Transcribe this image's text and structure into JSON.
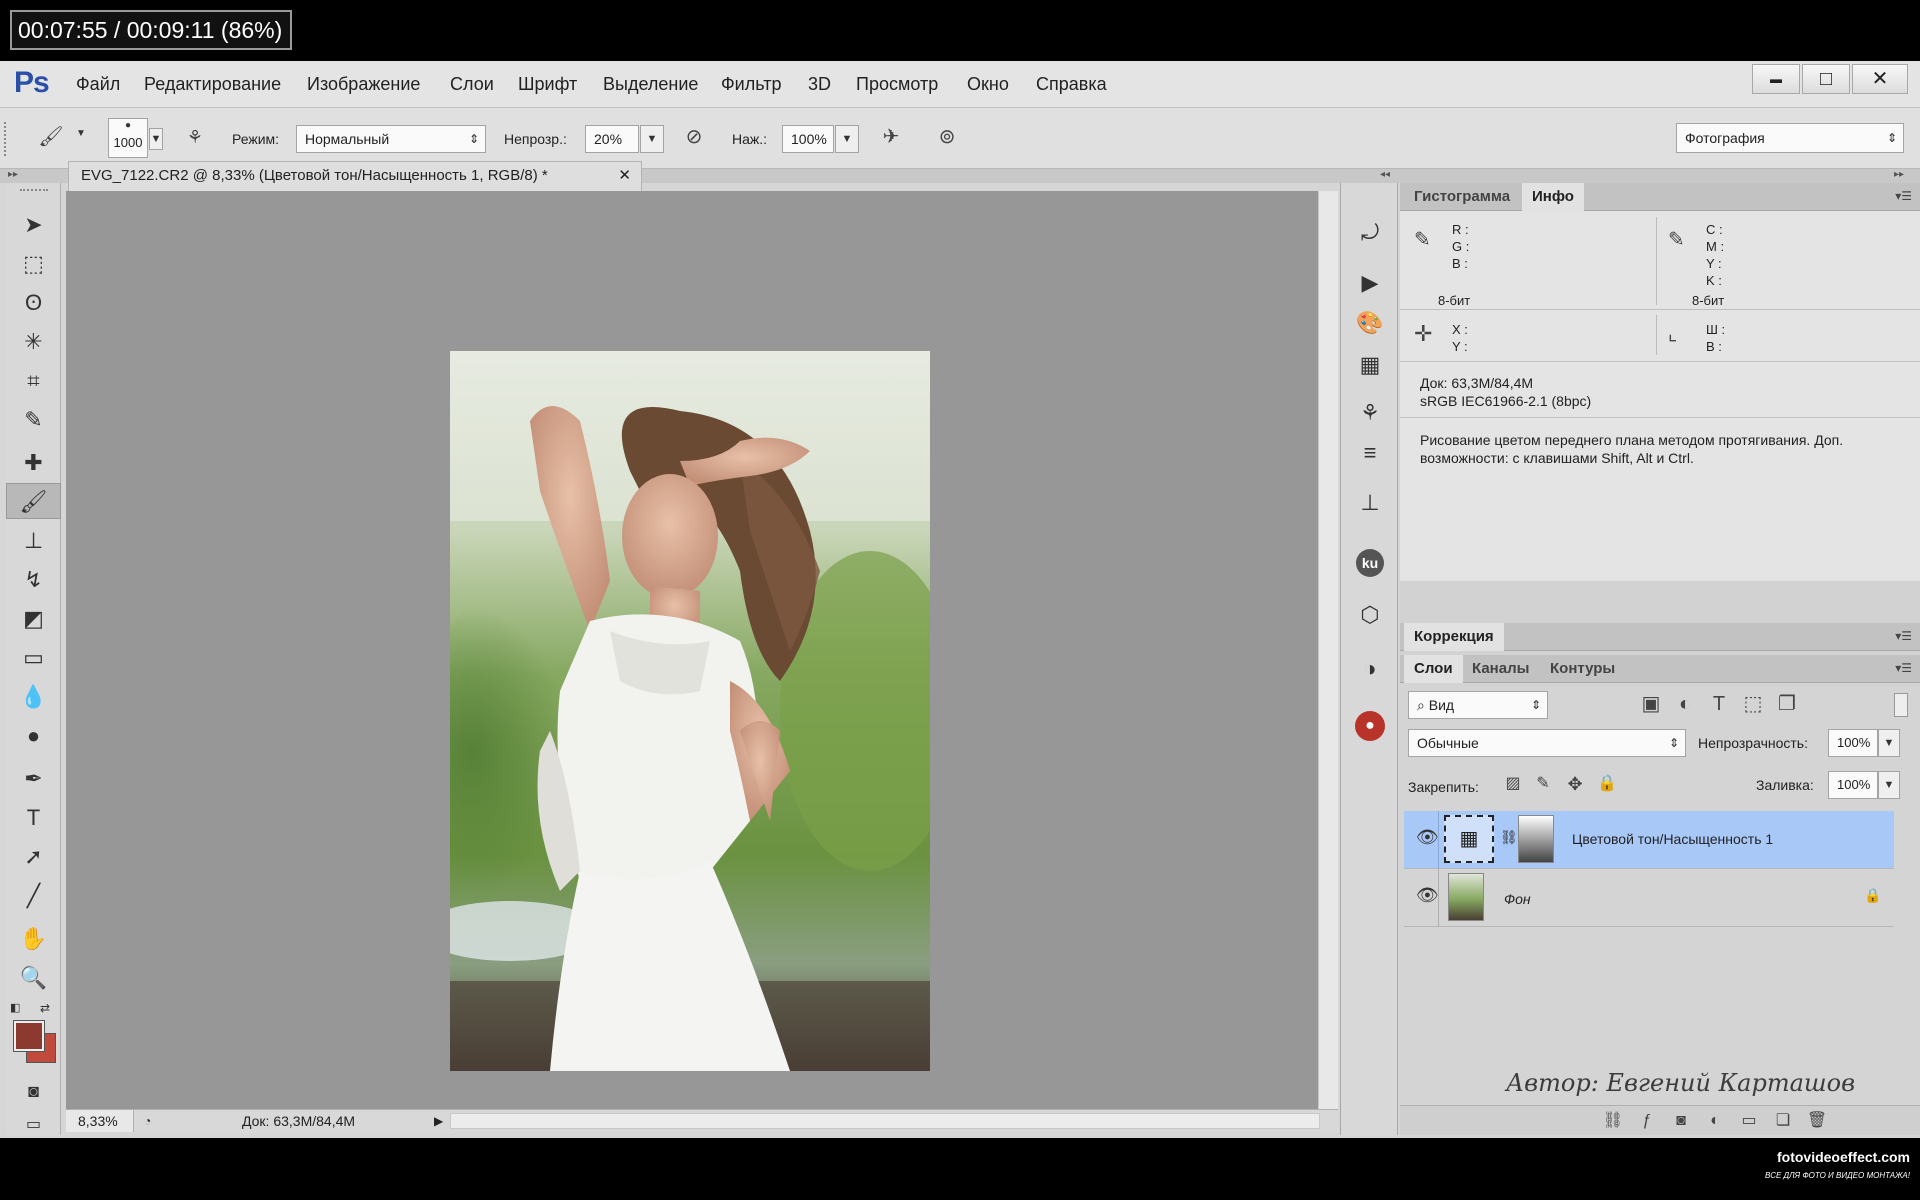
{
  "recording": {
    "timer": "00:07:55 / 00:09:11 (86%)"
  },
  "app": {
    "logo": "Ps",
    "menu": [
      "Файл",
      "Редактирование",
      "Изображение",
      "Слои",
      "Шрифт",
      "Выделение",
      "Фильтр",
      "3D",
      "Просмотр",
      "Окно",
      "Справка"
    ],
    "window_buttons": {
      "minimize": "▬",
      "maximize": "□",
      "close": "✕"
    }
  },
  "options": {
    "brush_size": "1000",
    "mode_label": "Режим:",
    "mode_value": "Нормальный",
    "opacity_label": "Непрозр.:",
    "opacity_value": "20%",
    "pressure_label": "Наж.:",
    "pressure_value": "100%",
    "workspace": "Фотография"
  },
  "document": {
    "tab_title": "EVG_7122.CR2 @ 8,33% (Цветовой тон/Насыщенность 1, RGB/8) *",
    "close": "✕",
    "zoom": "8,33%",
    "doc_size": "Док: 63,3M/84,4M"
  },
  "panels": {
    "top_tabs": [
      "Гистограмма",
      "Инфо"
    ],
    "info": {
      "rgb": [
        "R :",
        "G :",
        "B :"
      ],
      "cmyk": [
        "C :",
        "M :",
        "Y :",
        "K :"
      ],
      "bit_left": "8-бит",
      "bit_right": "8-бит",
      "xy": [
        "X :",
        "Y :"
      ],
      "wh": [
        "Ш :",
        "В :"
      ],
      "doc": "Док: 63,3M/84,4M",
      "profile": "sRGB IEC61966-2.1 (8bpc)",
      "hint": "Рисование цветом переднего плана методом протягивания. Доп. возможности: с клавишами Shift, Alt и Ctrl."
    },
    "correction_tab": "Коррекция",
    "layer_tabs": [
      "Слои",
      "Каналы",
      "Контуры"
    ],
    "filter_kind": "Вид",
    "blend_mode": "Обычные",
    "opacity_label": "Непрозрачность:",
    "opacity_value": "100%",
    "lock_label": "Закрепить:",
    "fill_label": "Заливка:",
    "fill_value": "100%",
    "layers": [
      {
        "name": "Цветовой тон/Насыщенность 1",
        "selected": true
      },
      {
        "name": "Фон",
        "selected": false
      }
    ]
  },
  "overlay": {
    "author": "Автор: Евгений Карташов",
    "site": "fotovideoeffect.com",
    "site_tagline": "ВСЕ ДЛЯ ФОТО И ВИДЕО МОНТАЖА!"
  },
  "colors": {
    "accent": "#2a4fa8",
    "selected_layer": "#a8c8f8",
    "foreground": "#8c3a30",
    "background": "#c04a3c"
  }
}
